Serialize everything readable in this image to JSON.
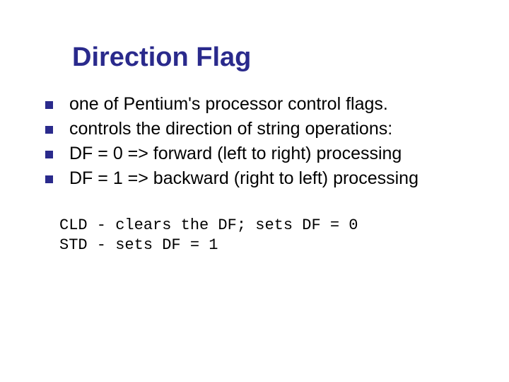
{
  "title": "Direction Flag",
  "bullets": [
    "one of Pentium's processor control flags.",
    "controls the direction of string operations:",
    "DF = 0 => forward (left to right) processing",
    "DF = 1 => backward (right to left) processing"
  ],
  "code": "CLD - clears the DF; sets DF = 0\nSTD - sets DF = 1"
}
